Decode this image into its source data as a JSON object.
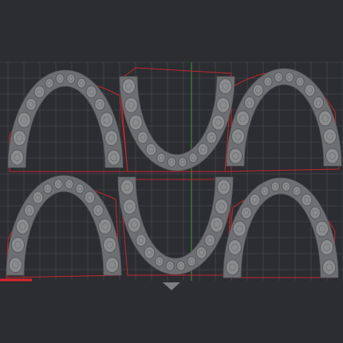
{
  "viewport": {
    "background": "#2b2d31",
    "grid_color": "#44474c",
    "plate_border_color": "#c0282d",
    "axis_x_color": "#e0242a",
    "axis_y_color": "#3b7a3b",
    "tooth_fill": "#8b8c8e",
    "tooth_edge": "#5a5b5d",
    "gum_fill": "#6e6f72"
  },
  "models": [
    {
      "name": "upper-arch-left-top",
      "kind": "upper-arch",
      "flipped": false
    },
    {
      "name": "lower-arch-middle-top",
      "kind": "lower-arch",
      "flipped": true
    },
    {
      "name": "upper-arch-right-top",
      "kind": "upper-arch",
      "flipped": false
    },
    {
      "name": "upper-arch-left-bottom",
      "kind": "upper-arch",
      "flipped": false
    },
    {
      "name": "lower-arch-middle-bottom",
      "kind": "lower-arch",
      "flipped": true
    },
    {
      "name": "upper-arch-right-bottom",
      "kind": "upper-arch",
      "flipped": false
    }
  ],
  "icons": {
    "nav_arrow": "triangle-down-icon"
  }
}
